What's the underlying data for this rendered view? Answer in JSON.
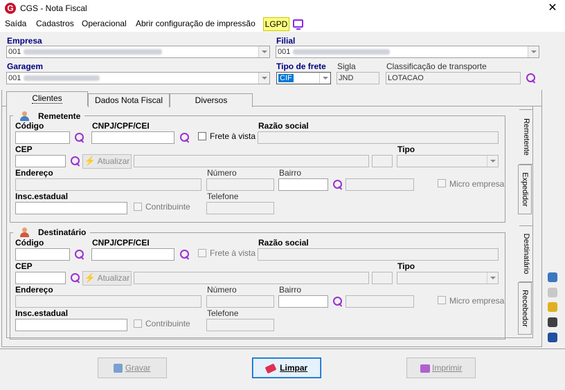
{
  "window": {
    "title": "CGS - Nota Fiscal",
    "logo_letter": "G",
    "close_symbol": "✕"
  },
  "menu": {
    "items": [
      "Saída",
      "Cadastros",
      "Operacional",
      "Abrir configuração de impressão"
    ],
    "lgpd": "LGPD"
  },
  "header": {
    "empresa_label": "Empresa",
    "empresa_value": "001",
    "filial_label": "Filial",
    "filial_value": "001",
    "garagem_label": "Garagem",
    "garagem_value": "001",
    "tipo_frete_label": "Tipo de frete",
    "tipo_frete_value": "CIF",
    "sigla_label": "Sigla",
    "sigla_value": "JND",
    "classificacao_label": "Classificação de transporte",
    "classificacao_value": "LOTACAO"
  },
  "tabs": [
    "Clientes",
    "Dados Nota Fiscal",
    "Diversos"
  ],
  "remetente": {
    "title": "Remetente",
    "codigo": "Código",
    "cnpj": "CNPJ/CPF/CEI",
    "frete_a_vista": "Frete à vista",
    "razao_social": "Razão social",
    "cep": "CEP",
    "atualizar": "Atualizar",
    "tipo": "Tipo",
    "endereco": "Endereço",
    "numero": "Número",
    "bairro": "Bairro",
    "micro_empresa": "Micro empresa",
    "insc_estadual": "Insc.estadual",
    "contribuinte": "Contribuinte",
    "telefone": "Telefone"
  },
  "destinatario": {
    "title": "Destinatário",
    "codigo": "Código",
    "cnpj": "CNPJ/CPF/CEI",
    "frete_a_vista": "Frete à vista",
    "razao_social": "Razão social",
    "cep": "CEP",
    "atualizar": "Atualizar",
    "tipo": "Tipo",
    "endereco": "Endereço",
    "numero": "Número",
    "bairro": "Bairro",
    "micro_empresa": "Micro empresa",
    "insc_estadual": "Insc.estadual",
    "contribuinte": "Contribuinte",
    "telefone": "Telefone"
  },
  "side_tabs": [
    "Remetente",
    "Expedidor",
    "Destinatário",
    "Recebedor"
  ],
  "buttons": {
    "gravar": "Gravar",
    "limpar": "Limpar",
    "imprimir": "Imprimir"
  },
  "colors": {
    "accent_purple": "#9b30d0",
    "label_blue": "#000080",
    "lgpd_bg": "#ffff80"
  }
}
